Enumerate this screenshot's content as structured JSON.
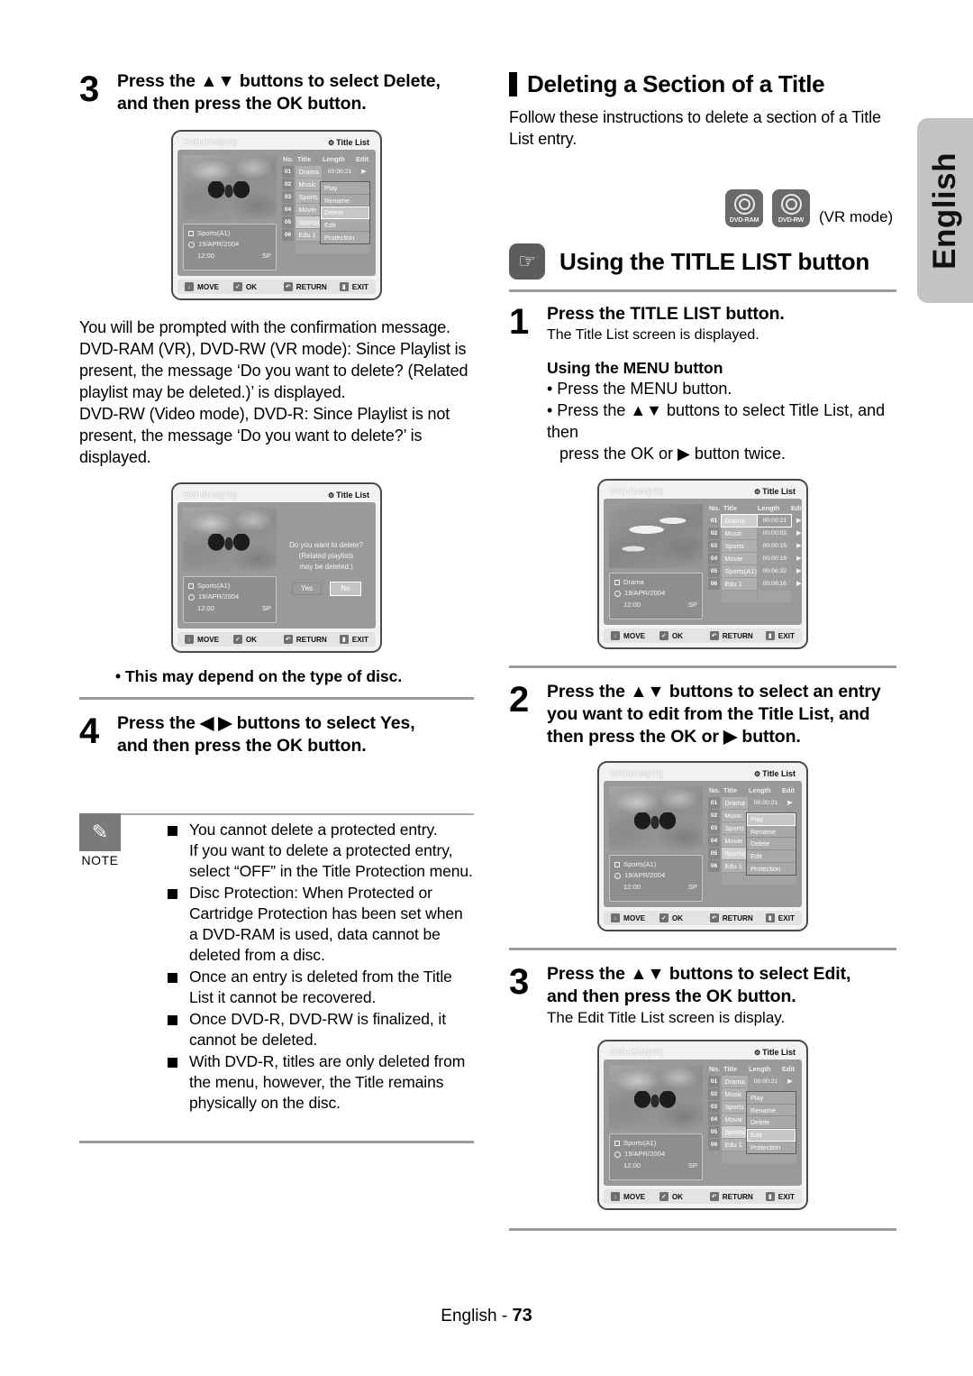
{
  "language_tab": "English",
  "footer": {
    "label": "English - ",
    "page": "73"
  },
  "left_column": {
    "step3": {
      "number": "3",
      "line1": "Press the ▲▼ buttons to select Delete,",
      "line2": "and then press the OK button."
    },
    "paragraph": "You will be prompted with the confirmation message.\nDVD-RAM (VR), DVD-RW (VR mode): Since Playlist is present, the message ‘Do you want to delete? (Related playlist may be deleted.)’ is displayed.\nDVD-RW (Video mode), DVD-R: Since Playlist is not present, the message ‘Do you want to delete?’ is displayed.",
    "disc_note": "• This may depend on the type of disc.",
    "step4": {
      "number": "4",
      "line1": "Press the ◀ ▶ buttons to select Yes,",
      "line2": "and then press the OK button."
    },
    "note": {
      "caption": "NOTE",
      "items": [
        "You cannot delete a protected entry.\nIf you want to delete a protected entry, select “OFF” in the Title Protection menu.",
        "Disc Protection: When Protected or Cartridge Protection has been set when a DVD-RAM is used, data cannot be deleted from a disc.",
        "Once an entry is deleted from the Title List it cannot be recovered.",
        "Once DVD-R, DVD-RW is finalized, it cannot be deleted.",
        "With DVD-R, titles are only deleted from the menu, however, the Title remains physically on the disc."
      ]
    }
  },
  "right_column": {
    "section_heading": "Deleting a Section of a Title",
    "section_intro": "Follow these instructions to delete a section of a Title List entry.",
    "discs": [
      {
        "label": "DVD-RAM"
      },
      {
        "label": "DVD-RW"
      }
    ],
    "vr_mode": "(VR mode)",
    "using_heading": "Using the TITLE LIST button",
    "step1": {
      "number": "1",
      "title": "Press the TITLE LIST button.",
      "sub": "The Title List screen is displayed."
    },
    "menu_block": {
      "heading": "Using the MENU button",
      "b1": "• Press the MENU button.",
      "b2": "• Press the ▲▼ buttons to select Title List, and then",
      "b3": "press the OK or ▶ button twice."
    },
    "step2": {
      "number": "2",
      "line1": "Press the ▲▼ buttons to select an entry",
      "line2": "you want to edit from the Title List, and",
      "line3": "then press the OK or ▶ button."
    },
    "step3": {
      "number": "3",
      "line1": "Press the ▲▼ buttons to select Edit,",
      "line2": "and then press the OK button.",
      "sub": "The Edit Title List screen is display."
    }
  },
  "screens": {
    "common": {
      "disc_label": "DVD-RAM(VR)",
      "title_list": "Title List",
      "headers": {
        "no": "No.",
        "title": "Title",
        "length": "Length",
        "edit": "Edit"
      },
      "footer_keys": [
        {
          "key": "↕",
          "label": "MOVE"
        },
        {
          "key": "✓",
          "label": "OK"
        },
        {
          "key": "↶",
          "label": "RETURN"
        },
        {
          "key": "▮",
          "label": "EXIT"
        }
      ],
      "rows": [
        {
          "no": "01",
          "title": "Drama",
          "length": "00:00:21"
        },
        {
          "no": "02",
          "title": "Music",
          "length": "00:00:03"
        },
        {
          "no": "03",
          "title": "Sports",
          "length": "00:00:15"
        },
        {
          "no": "04",
          "title": "Movie",
          "length": "00:00:16"
        },
        {
          "no": "05",
          "title": "Sports(A1)",
          "length": "00:06:32"
        },
        {
          "no": "06",
          "title": "Edu 1",
          "length": "00:08:16"
        }
      ],
      "popup_items": [
        "Play",
        "Rename",
        "Delete",
        "Edit",
        "Protection"
      ]
    },
    "screen_left_1": {
      "info": {
        "name": "Sports(A1)",
        "date": "19/APR/2004",
        "time": "12:00",
        "mode": "SP"
      },
      "selected_row": "05",
      "popup_selected": "Delete"
    },
    "screen_left_2": {
      "info": {
        "name": "Sports(A1)",
        "date": "19/APR/2004",
        "time": "12:00",
        "mode": "SP"
      },
      "dialog": {
        "line1": "Do you want to delete?",
        "line2": "(Related playlists",
        "line3": "may be deleted.)",
        "yes": "Yes",
        "no": "No",
        "selected": "No"
      }
    },
    "screen_right_1": {
      "info": {
        "name": "Drama",
        "date": "19/APR/2004",
        "time": "12:00",
        "mode": "SP"
      },
      "selected_row": "01"
    },
    "screen_right_2": {
      "info": {
        "name": "Sports(A1)",
        "date": "19/APR/2004",
        "time": "12:00",
        "mode": "SP"
      },
      "selected_row": "05",
      "popup_selected": "Play"
    },
    "screen_right_3": {
      "info": {
        "name": "Sports(A1)",
        "date": "19/APR/2004",
        "time": "12:00",
        "mode": "SP"
      },
      "selected_row": "05",
      "popup_selected": "Edit"
    }
  },
  "colors": {
    "screen_bg": "#9a9a9a",
    "tab_bg": "#c3c3c3",
    "note_badge": "#7a7a7a",
    "rule": "#9a9a9a"
  }
}
